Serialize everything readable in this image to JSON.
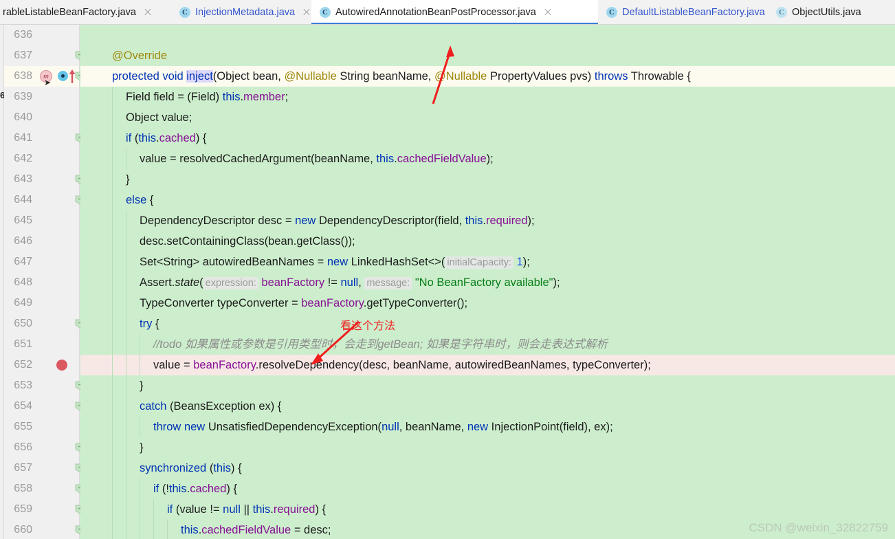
{
  "window": {
    "app": "IntelliJ IDEA Editor",
    "watermark": "CSDN @weixin_32822759"
  },
  "tabs": [
    {
      "label": "rableListableBeanFactory.java",
      "icon": "java-class-icon",
      "active": false,
      "truncated": true,
      "color": "dark",
      "closable": true
    },
    {
      "label": "InjectionMetadata.java",
      "icon": "java-class-icon",
      "active": false,
      "truncated": false,
      "color": "blue",
      "closable": true
    },
    {
      "label": "AutowiredAnnotationBeanPostProcessor.java",
      "icon": "java-class-icon",
      "active": true,
      "truncated": false,
      "color": "dark",
      "closable": true
    },
    {
      "label": "DefaultListableBeanFactory.java",
      "icon": "java-class-icon",
      "active": false,
      "truncated": false,
      "color": "blue",
      "closable": true
    },
    {
      "label": "ObjectUtils.java",
      "icon": "java-class-icon",
      "active": false,
      "truncated": true,
      "color": "dark",
      "closable": false
    }
  ],
  "gutter": {
    "first_line": 636,
    "last_line": 660,
    "breakpoint_line": 652,
    "current_line": 638,
    "markers": [
      {
        "line": 638,
        "name": "override-method-marker",
        "glyph": "m"
      },
      {
        "line": 638,
        "name": "implemented-method-marker",
        "glyph": "o"
      },
      {
        "line": 638,
        "name": "navigate-up-arrow-icon",
        "glyph": "↑"
      }
    ],
    "fold_lines": [
      637,
      638,
      641,
      643,
      644,
      650,
      653,
      654,
      656,
      657,
      658,
      659,
      660
    ]
  },
  "annotations": [
    {
      "text": "看这个方法",
      "name": "red-annotation-method-note"
    }
  ],
  "code_lines": [
    {
      "num": 636,
      "indent": 0,
      "tokens": []
    },
    {
      "num": 637,
      "indent": 1,
      "tokens": [
        {
          "t": "@Override",
          "c": "anno"
        }
      ]
    },
    {
      "num": 638,
      "indent": 1,
      "highlight": "current",
      "tokens": [
        {
          "t": "protected",
          "c": "kw"
        },
        {
          "t": " "
        },
        {
          "t": "void",
          "c": "kw"
        },
        {
          "t": " "
        },
        {
          "t": "inject",
          "c": "sel-word kw"
        },
        {
          "t": "(Object bean, "
        },
        {
          "t": "@Nullable",
          "c": "anno"
        },
        {
          "t": " String beanName, "
        },
        {
          "t": "@Nullable",
          "c": "anno"
        },
        {
          "t": " PropertyValues pvs) "
        },
        {
          "t": "throws",
          "c": "kw"
        },
        {
          "t": " Throwable {"
        }
      ]
    },
    {
      "num": 639,
      "indent": 2,
      "tokens": [
        {
          "t": "Field field = (Field) "
        },
        {
          "t": "this",
          "c": "kw"
        },
        {
          "t": "."
        },
        {
          "t": "member",
          "c": "fld"
        },
        {
          "t": ";"
        }
      ]
    },
    {
      "num": 640,
      "indent": 2,
      "tokens": [
        {
          "t": "Object value;"
        }
      ]
    },
    {
      "num": 641,
      "indent": 2,
      "tokens": [
        {
          "t": "if",
          "c": "kw"
        },
        {
          "t": " ("
        },
        {
          "t": "this",
          "c": "kw"
        },
        {
          "t": "."
        },
        {
          "t": "cached",
          "c": "fld"
        },
        {
          "t": ") {"
        }
      ]
    },
    {
      "num": 642,
      "indent": 3,
      "tokens": [
        {
          "t": "value = resolvedCachedArgument(beanName, "
        },
        {
          "t": "this",
          "c": "kw"
        },
        {
          "t": "."
        },
        {
          "t": "cachedFieldValue",
          "c": "fld"
        },
        {
          "t": ");"
        }
      ]
    },
    {
      "num": 643,
      "indent": 2,
      "tokens": [
        {
          "t": "}"
        }
      ]
    },
    {
      "num": 644,
      "indent": 2,
      "tokens": [
        {
          "t": "else",
          "c": "kw"
        },
        {
          "t": " {"
        }
      ]
    },
    {
      "num": 645,
      "indent": 3,
      "tokens": [
        {
          "t": "DependencyDescriptor desc = "
        },
        {
          "t": "new",
          "c": "kw"
        },
        {
          "t": " DependencyDescriptor(field, "
        },
        {
          "t": "this",
          "c": "kw"
        },
        {
          "t": "."
        },
        {
          "t": "required",
          "c": "fld"
        },
        {
          "t": ");"
        }
      ]
    },
    {
      "num": 646,
      "indent": 3,
      "tokens": [
        {
          "t": "desc.setContainingClass(bean.getClass());"
        }
      ]
    },
    {
      "num": 647,
      "indent": 3,
      "tokens": [
        {
          "t": "Set<String> autowiredBeanNames = "
        },
        {
          "t": "new",
          "c": "kw"
        },
        {
          "t": " LinkedHashSet<>("
        },
        {
          "t": "initialCapacity:",
          "c": "hint"
        },
        {
          "t": " "
        },
        {
          "t": "1",
          "c": "num"
        },
        {
          "t": ");"
        }
      ]
    },
    {
      "num": 648,
      "indent": 3,
      "tokens": [
        {
          "t": "Assert."
        },
        {
          "t": "state",
          "c": "stat"
        },
        {
          "t": "("
        },
        {
          "t": "expression:",
          "c": "hint"
        },
        {
          "t": " "
        },
        {
          "t": "beanFactory",
          "c": "fld"
        },
        {
          "t": " != "
        },
        {
          "t": "null",
          "c": "kw"
        },
        {
          "t": ", "
        },
        {
          "t": "message:",
          "c": "hint"
        },
        {
          "t": " "
        },
        {
          "t": "\"No BeanFactory available\"",
          "c": "str"
        },
        {
          "t": ");"
        }
      ]
    },
    {
      "num": 649,
      "indent": 3,
      "tokens": [
        {
          "t": "TypeConverter typeConverter = "
        },
        {
          "t": "beanFactory",
          "c": "fld"
        },
        {
          "t": ".getTypeConverter();"
        }
      ]
    },
    {
      "num": 650,
      "indent": 3,
      "tokens": [
        {
          "t": "try",
          "c": "kw"
        },
        {
          "t": " {"
        }
      ]
    },
    {
      "num": 651,
      "indent": 4,
      "tokens": [
        {
          "t": "//todo 如果属性或参数是引用类型时，会走到getBean; 如果是字符串时，则会走表达式解析",
          "c": "cmt"
        }
      ]
    },
    {
      "num": 652,
      "indent": 4,
      "highlight": "exec",
      "tokens": [
        {
          "t": "value = "
        },
        {
          "t": "beanFactory",
          "c": "fld"
        },
        {
          "t": ".resolveDependency(desc, beanName, autowiredBeanNames, typeConverter);"
        }
      ]
    },
    {
      "num": 653,
      "indent": 3,
      "tokens": [
        {
          "t": "}"
        }
      ]
    },
    {
      "num": 654,
      "indent": 3,
      "tokens": [
        {
          "t": "catch",
          "c": "kw"
        },
        {
          "t": " (BeansException ex) {"
        }
      ]
    },
    {
      "num": 655,
      "indent": 4,
      "tokens": [
        {
          "t": "throw",
          "c": "kw"
        },
        {
          "t": " "
        },
        {
          "t": "new",
          "c": "kw"
        },
        {
          "t": " UnsatisfiedDependencyException("
        },
        {
          "t": "null",
          "c": "kw"
        },
        {
          "t": ", beanName, "
        },
        {
          "t": "new",
          "c": "kw"
        },
        {
          "t": " InjectionPoint(field), ex);"
        }
      ]
    },
    {
      "num": 656,
      "indent": 3,
      "tokens": [
        {
          "t": "}"
        }
      ]
    },
    {
      "num": 657,
      "indent": 3,
      "tokens": [
        {
          "t": "synchronized",
          "c": "kw"
        },
        {
          "t": " ("
        },
        {
          "t": "this",
          "c": "kw"
        },
        {
          "t": ") {"
        }
      ]
    },
    {
      "num": 658,
      "indent": 4,
      "tokens": [
        {
          "t": "if",
          "c": "kw"
        },
        {
          "t": " (!"
        },
        {
          "t": "this",
          "c": "kw"
        },
        {
          "t": "."
        },
        {
          "t": "cached",
          "c": "fld"
        },
        {
          "t": ") {"
        }
      ]
    },
    {
      "num": 659,
      "indent": 5,
      "tokens": [
        {
          "t": "if",
          "c": "kw"
        },
        {
          "t": " (value != "
        },
        {
          "t": "null",
          "c": "kw"
        },
        {
          "t": " || "
        },
        {
          "t": "this",
          "c": "kw"
        },
        {
          "t": "."
        },
        {
          "t": "required",
          "c": "fld"
        },
        {
          "t": ") {"
        }
      ]
    },
    {
      "num": 660,
      "indent": 6,
      "tokens": [
        {
          "t": "this",
          "c": "kw"
        },
        {
          "t": "."
        },
        {
          "t": "cachedFieldValue",
          "c": "fld"
        },
        {
          "t": " = desc;"
        }
      ]
    }
  ],
  "colors": {
    "editor_background": "#cdeecd",
    "current_line_highlight": "#fdfbf0",
    "execution_line_highlight": "#f7e8e6",
    "gutter_background": "#f0f0f0",
    "active_tab_underline": "#3b7dd8",
    "breakpoint": "#db5860",
    "annotation_red": "#f01f1f",
    "keyword": "#0033b3",
    "field": "#871094",
    "string": "#067d17",
    "annotation_token": "#9e880d",
    "comment": "#8c8c8c"
  }
}
